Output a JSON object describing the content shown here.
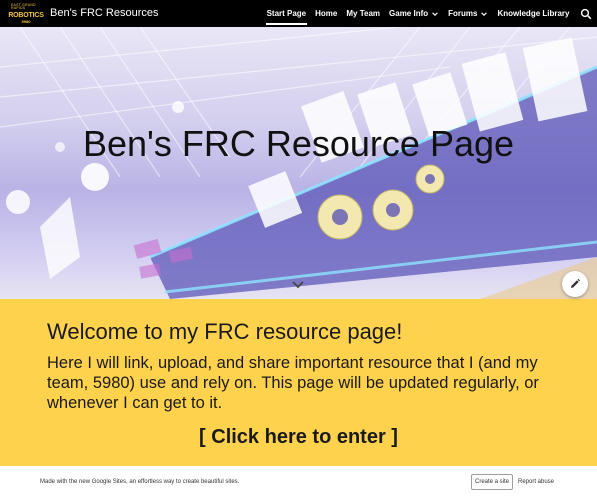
{
  "header": {
    "logo": {
      "line1": "EAST GRAND RAPIDS",
      "line2": "ROBOTICS",
      "line3": "5980"
    },
    "site_title": "Ben's FRC Resources",
    "nav": [
      {
        "label": "Start Page",
        "active": true,
        "dropdown": false
      },
      {
        "label": "Home",
        "active": false,
        "dropdown": false
      },
      {
        "label": "My Team",
        "active": false,
        "dropdown": false
      },
      {
        "label": "Game Info",
        "active": false,
        "dropdown": true
      },
      {
        "label": "Forums",
        "active": false,
        "dropdown": true
      },
      {
        "label": "Knowledge Library",
        "active": false,
        "dropdown": false
      }
    ],
    "search_icon": "search-icon"
  },
  "hero": {
    "title": "Ben's FRC Resource Page",
    "scroll_icon": "chevron-down-icon",
    "edit_icon": "pencil-icon"
  },
  "content": {
    "heading": "Welcome to my FRC resource page!",
    "body": "Here I will link, upload, and share important resource that I (and my team, 5980) use and rely on. This page will be updated regularly, or whenever I can get to it.",
    "link": "[ Click here to enter ]"
  },
  "footer": {
    "text": "Made with the new Google Sites, an effortless way to create beautiful sites.",
    "create_button": "Create a site",
    "report_link": "Report abuse"
  },
  "colors": {
    "topbar": "#000000",
    "section_bg": "#ffd24d",
    "hero_tint": "#b9b3e6"
  }
}
